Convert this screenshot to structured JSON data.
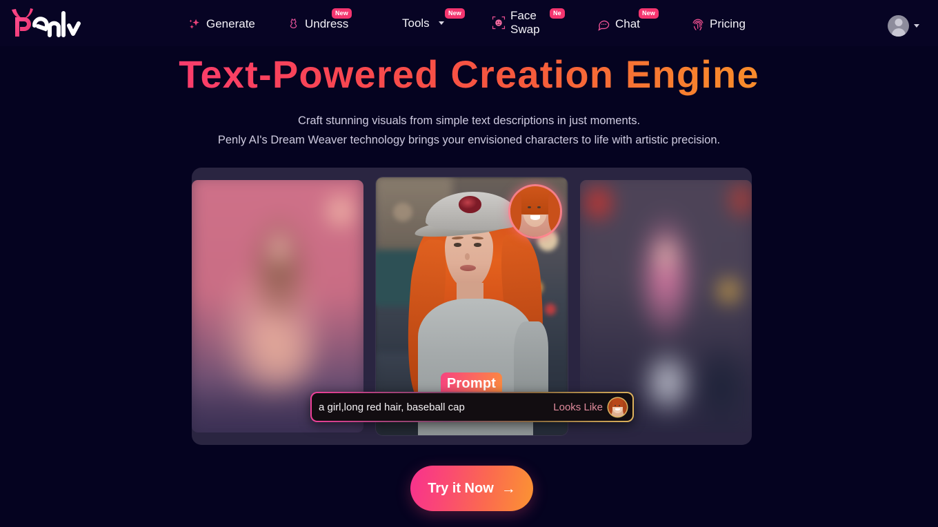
{
  "brand": {
    "name": "Penly",
    "logo_icon": "penly-devil-logo"
  },
  "nav": {
    "items": [
      {
        "label": "Generate",
        "icon": "sparkles-icon",
        "badge": null
      },
      {
        "label": "Undress",
        "icon": "dress-icon",
        "badge": "New"
      },
      {
        "label": "Tools",
        "icon": null,
        "badge": "New",
        "has_dropdown": true
      },
      {
        "label": "Face Swap",
        "icon": "face-scan-icon",
        "badge": "Ne"
      },
      {
        "label": "Chat",
        "icon": "chat-bubble-icon",
        "badge": "New"
      },
      {
        "label": "Pricing",
        "icon": "fingerprint-icon",
        "badge": null
      }
    ],
    "account": {
      "avatar_icon": "user-avatar-icon",
      "chevron_icon": "chevron-down-icon"
    }
  },
  "hero": {
    "title": "Text-Powered Creation Engine",
    "subtitle_line1": "Craft stunning visuals from simple text descriptions in just moments.",
    "subtitle_line2": "Penly AI's Dream Weaver technology brings your envisioned characters to life with artistic precision."
  },
  "carousel": {
    "slides": [
      {
        "name": "blurred-blonde-portrait",
        "position": "left"
      },
      {
        "name": "red-haired-woman-baseball-cap",
        "position": "center"
      },
      {
        "name": "blurred-pink-haired-portrait",
        "position": "right"
      }
    ]
  },
  "prompt": {
    "badge_label": "Prompt",
    "text": "a girl,long red hair, baseball cap",
    "looks_like_label": "Looks Like",
    "reference_thumb_icon": "reference-face-thumbnail"
  },
  "cta": {
    "label": "Try it Now",
    "arrow": "→"
  },
  "colors": {
    "background": "#050320",
    "navbar": "#070424",
    "carousel_panel": "#2a2541",
    "accent_pink": "#f4356f",
    "accent_orange": "#f9a827",
    "gradient_start": "#ff2d8a",
    "gradient_end": "#f9a827",
    "looks_like_text": "#e08b9c",
    "prompt_border_gold": "#e0b45d"
  }
}
